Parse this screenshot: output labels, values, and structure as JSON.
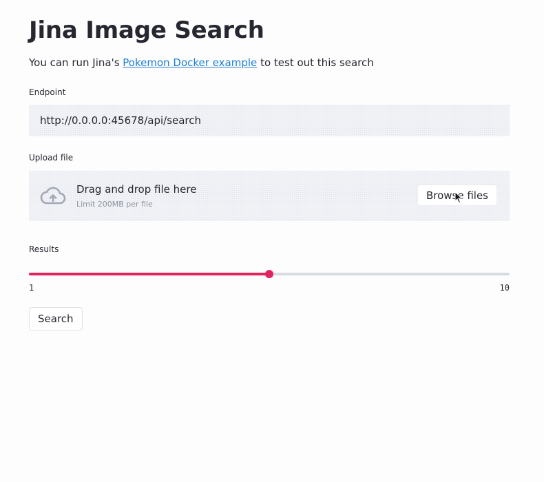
{
  "page": {
    "title": "Jina Image Search",
    "intro_prefix": "You can run Jina's ",
    "intro_link": "Pokemon Docker example",
    "intro_suffix": " to test out this search"
  },
  "endpoint": {
    "label": "Endpoint",
    "value": "http://0.0.0.0:45678/api/search"
  },
  "upload": {
    "label": "Upload file",
    "drop_text": "Drag and drop file here",
    "limit_text": "Limit 200MB per file",
    "browse_label": "Browse files",
    "icon": "cloud-upload-icon"
  },
  "results": {
    "label": "Results",
    "min": 1,
    "max": 10,
    "value": 5.5,
    "min_label": "1",
    "max_label": "10"
  },
  "search_button": {
    "label": "Search"
  },
  "colors": {
    "accent": "#e0245e",
    "link": "#1c7ed6",
    "text": "#262730",
    "input_bg": "#f0f2f6"
  }
}
